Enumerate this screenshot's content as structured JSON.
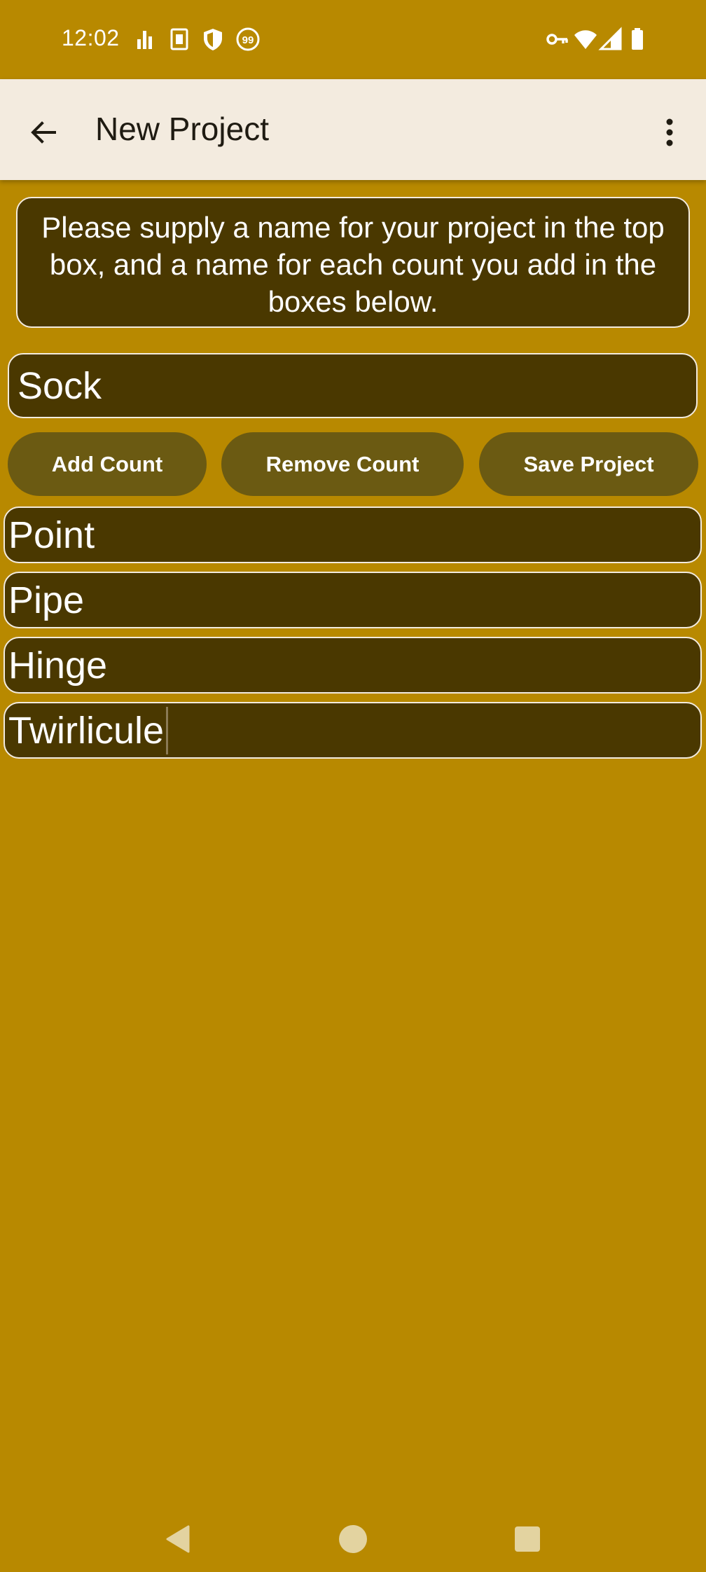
{
  "status_bar": {
    "time": "12:02",
    "left_icons": [
      "signal-bars-icon",
      "sim-card-icon",
      "shield-icon",
      "notification-99-icon"
    ],
    "right_icons": [
      "vpn-key-icon",
      "wifi-icon",
      "cell-signal-icon",
      "battery-icon"
    ]
  },
  "app_bar": {
    "title": "New Project",
    "back_icon": "arrow-back-icon",
    "menu_icon": "more-vert-icon"
  },
  "instructions": {
    "text": "Please supply a name for your project in the top box, and a name for each count you add in the boxes below."
  },
  "project_name": {
    "value": "Sock"
  },
  "buttons": {
    "add_count": "Add Count",
    "remove_count": "Remove Count",
    "save_project": "Save Project"
  },
  "counts": [
    {
      "value": "Point"
    },
    {
      "value": "Pipe"
    },
    {
      "value": "Hinge"
    },
    {
      "value": "Twirlicule"
    }
  ],
  "colors": {
    "background": "#B88900",
    "field_bg": "#4A3800",
    "button_bg": "#6B5A12",
    "app_bar_bg": "#F3EBDF"
  }
}
